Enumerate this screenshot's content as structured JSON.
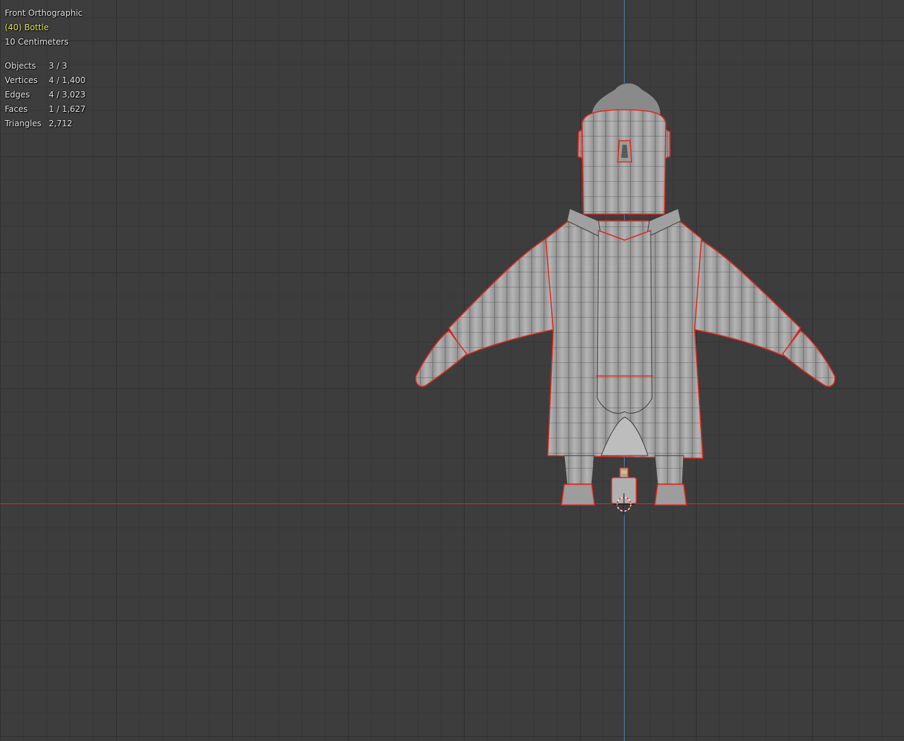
{
  "viewport": {
    "view_name": "Front Orthographic",
    "active_object": "(40) Bottle",
    "grid_scale": "10 Centimeters"
  },
  "stats": [
    {
      "label": "Objects",
      "value": "3 / 3"
    },
    {
      "label": "Vertices",
      "value": "4 / 1,400"
    },
    {
      "label": "Edges",
      "value": "4 / 3,023"
    },
    {
      "label": "Faces",
      "value": "1 / 1,627"
    },
    {
      "label": "Triangles",
      "value": "2,712"
    }
  ],
  "colors": {
    "background": "#3d3d3d",
    "grid_major": "#2f2f2f",
    "grid_minor": "#363636",
    "axis_x": "#b8404a",
    "axis_z": "#4f7fb4",
    "mesh_fill": "#a9a9a9",
    "mesh_wire": "#3a3a3a",
    "selection_outline": "#e0281e",
    "active_object_text": "#e8e84f"
  }
}
